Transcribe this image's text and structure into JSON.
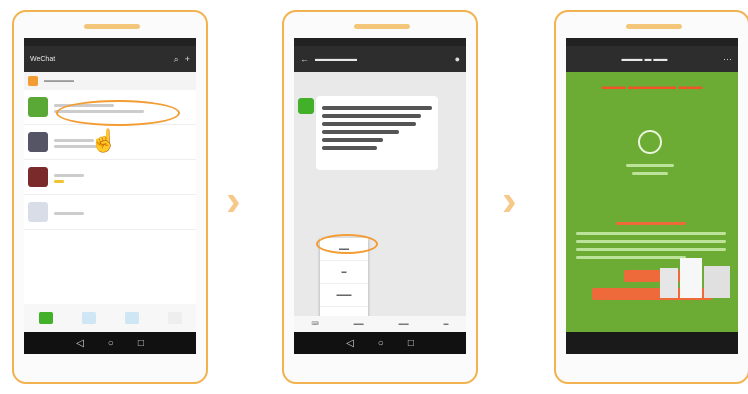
{
  "phones": [
    {
      "appbar_title": "WeChat",
      "list_items": [
        "",
        "",
        "",
        ""
      ],
      "tabs": [
        "",
        "",
        "",
        ""
      ]
    },
    {
      "chat_title": "",
      "menu_items": [
        "",
        "",
        "",
        ""
      ]
    },
    {
      "page_title": "",
      "banner_text": ""
    }
  ],
  "accent_color": "#f39c33",
  "arrow_color": "#f6c98a"
}
